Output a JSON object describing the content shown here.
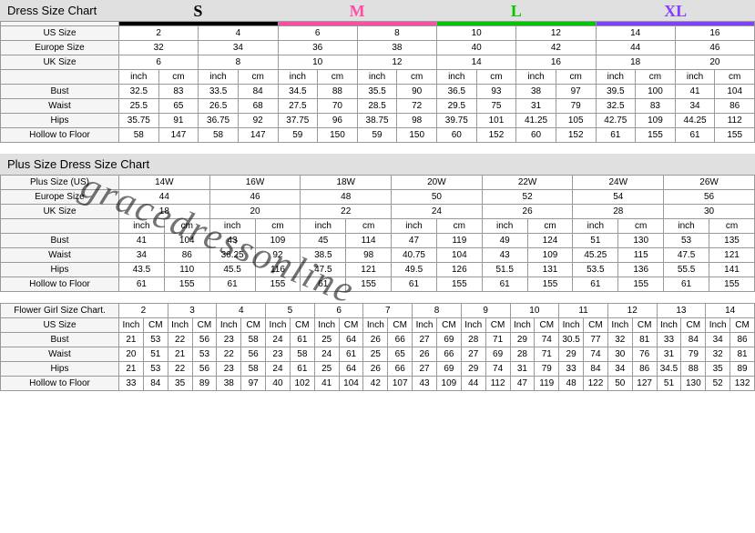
{
  "watermark": "gracedressonline",
  "letters": {
    "s": "S",
    "m": "M",
    "l": "L",
    "xl": "XL"
  },
  "colors": {
    "s": "#000",
    "m": "#ff4da6",
    "l": "#00c800",
    "xl": "#8040ff"
  },
  "t1": {
    "title": "Dress Size Chart",
    "rows": {
      "us": {
        "label": "US Size",
        "v": [
          "2",
          "4",
          "6",
          "8",
          "10",
          "12",
          "14",
          "16"
        ]
      },
      "eu": {
        "label": "Europe Size",
        "v": [
          "32",
          "34",
          "36",
          "38",
          "40",
          "42",
          "44",
          "46"
        ]
      },
      "uk": {
        "label": "UK Size",
        "v": [
          "6",
          "8",
          "10",
          "12",
          "14",
          "16",
          "18",
          "20"
        ]
      },
      "unit": {
        "i": "inch",
        "c": "cm"
      },
      "bust": {
        "label": "Bust",
        "v": [
          "32.5",
          "83",
          "33.5",
          "84",
          "34.5",
          "88",
          "35.5",
          "90",
          "36.5",
          "93",
          "38",
          "97",
          "39.5",
          "100",
          "41",
          "104"
        ]
      },
      "waist": {
        "label": "Waist",
        "v": [
          "25.5",
          "65",
          "26.5",
          "68",
          "27.5",
          "70",
          "28.5",
          "72",
          "29.5",
          "75",
          "31",
          "79",
          "32.5",
          "83",
          "34",
          "86"
        ]
      },
      "hips": {
        "label": "Hips",
        "v": [
          "35.75",
          "91",
          "36.75",
          "92",
          "37.75",
          "96",
          "38.75",
          "98",
          "39.75",
          "101",
          "41.25",
          "105",
          "42.75",
          "109",
          "44.25",
          "112"
        ]
      },
      "htf": {
        "label": "Hollow to Floor",
        "v": [
          "58",
          "147",
          "58",
          "147",
          "59",
          "150",
          "59",
          "150",
          "60",
          "152",
          "60",
          "152",
          "61",
          "155",
          "61",
          "155"
        ]
      }
    }
  },
  "t2": {
    "title": "Plus Size Dress Size Chart",
    "rows": {
      "plus": {
        "label": "Plus Size (US)",
        "v": [
          "14W",
          "16W",
          "18W",
          "20W",
          "22W",
          "24W",
          "26W"
        ]
      },
      "eu": {
        "label": "Europe Size",
        "v": [
          "44",
          "46",
          "48",
          "50",
          "52",
          "54",
          "56"
        ]
      },
      "uk": {
        "label": "UK Size",
        "v": [
          "18",
          "20",
          "22",
          "24",
          "26",
          "28",
          "30"
        ]
      },
      "unit": {
        "i": "inch",
        "c": "cm"
      },
      "bust": {
        "label": "Bust",
        "v": [
          "41",
          "104",
          "43",
          "109",
          "45",
          "114",
          "47",
          "119",
          "49",
          "124",
          "51",
          "130",
          "53",
          "135"
        ]
      },
      "waist": {
        "label": "Waist",
        "v": [
          "34",
          "86",
          "36.25",
          "92",
          "38.5",
          "98",
          "40.75",
          "104",
          "43",
          "109",
          "45.25",
          "115",
          "47.5",
          "121"
        ]
      },
      "hips": {
        "label": "Hips",
        "v": [
          "43.5",
          "110",
          "45.5",
          "116",
          "47.5",
          "121",
          "49.5",
          "126",
          "51.5",
          "131",
          "53.5",
          "136",
          "55.5",
          "141"
        ]
      },
      "htf": {
        "label": "Hollow to Floor",
        "v": [
          "61",
          "155",
          "61",
          "155",
          "61",
          "155",
          "61",
          "155",
          "61",
          "155",
          "61",
          "155",
          "61",
          "155"
        ]
      }
    }
  },
  "t3": {
    "title": "Flower Girl Size Chart.",
    "sizes": [
      "2",
      "3",
      "4",
      "5",
      "6",
      "7",
      "8",
      "9",
      "10",
      "11",
      "12",
      "13",
      "14"
    ],
    "unit": {
      "i": "Inch",
      "c": "CM"
    },
    "us": {
      "label": "US Size"
    },
    "bust": {
      "label": "Bust",
      "v": [
        "21",
        "53",
        "22",
        "56",
        "23",
        "58",
        "24",
        "61",
        "25",
        "64",
        "26",
        "66",
        "27",
        "69",
        "28",
        "71",
        "29",
        "74",
        "30.5",
        "77",
        "32",
        "81",
        "33",
        "84",
        "34",
        "86"
      ]
    },
    "waist": {
      "label": "Waist",
      "v": [
        "20",
        "51",
        "21",
        "53",
        "22",
        "56",
        "23",
        "58",
        "24",
        "61",
        "25",
        "65",
        "26",
        "66",
        "27",
        "69",
        "28",
        "71",
        "29",
        "74",
        "30",
        "76",
        "31",
        "79",
        "32",
        "81"
      ]
    },
    "hips": {
      "label": "Hips",
      "v": [
        "21",
        "53",
        "22",
        "56",
        "23",
        "58",
        "24",
        "61",
        "25",
        "64",
        "26",
        "66",
        "27",
        "69",
        "29",
        "74",
        "31",
        "79",
        "33",
        "84",
        "34",
        "86",
        "34.5",
        "88",
        "35",
        "89"
      ]
    },
    "htf": {
      "label": "Hollow to Floor",
      "v": [
        "33",
        "84",
        "35",
        "89",
        "38",
        "97",
        "40",
        "102",
        "41",
        "104",
        "42",
        "107",
        "43",
        "109",
        "44",
        "112",
        "47",
        "119",
        "48",
        "122",
        "50",
        "127",
        "51",
        "130",
        "52",
        "132"
      ]
    }
  }
}
